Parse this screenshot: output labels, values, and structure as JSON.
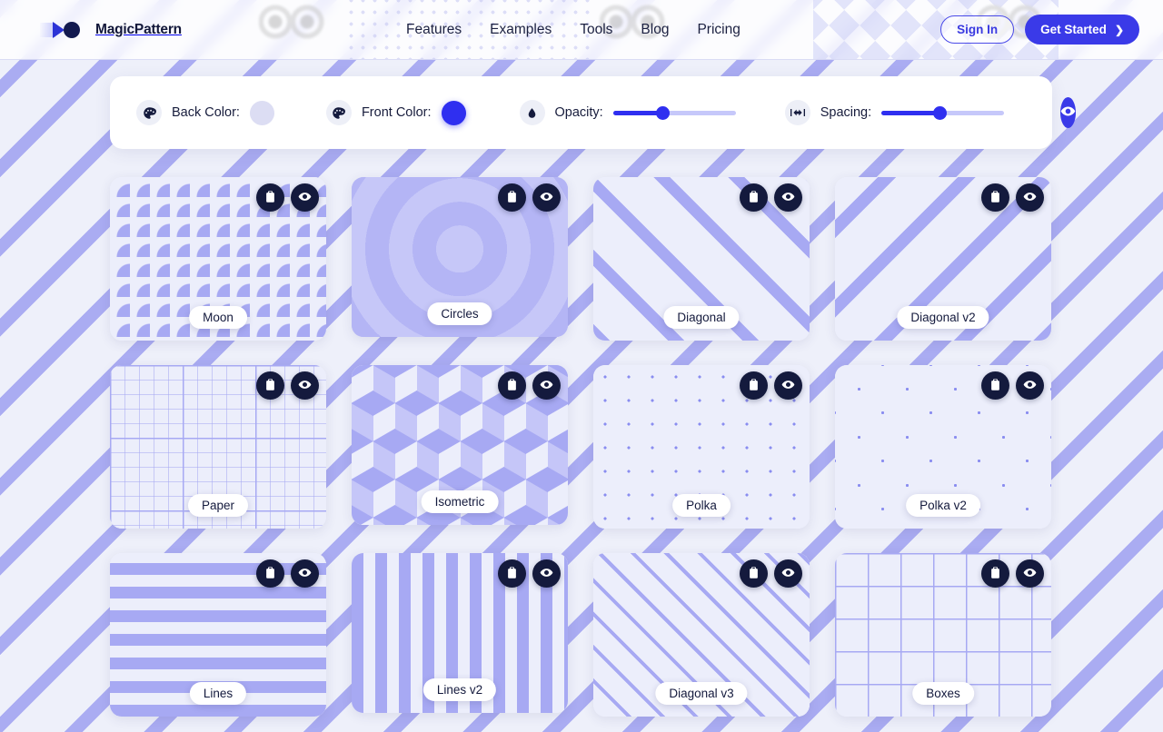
{
  "header": {
    "brand": "MagicPattern",
    "nav": [
      {
        "label": "Features"
      },
      {
        "label": "Examples"
      },
      {
        "label": "Tools"
      },
      {
        "label": "Blog"
      },
      {
        "label": "Pricing"
      }
    ],
    "sign_in_label": "Sign In",
    "get_started_label": "Get Started",
    "get_started_chevron": "❯"
  },
  "controls": {
    "back_color": {
      "label": "Back Color:",
      "icon": "palette-icon",
      "value": "#DCDDF3"
    },
    "front_color": {
      "label": "Front Color:",
      "icon": "palette-icon",
      "value": "#2F2FF0"
    },
    "opacity": {
      "label": "Opacity:",
      "icon": "droplet-icon",
      "percent": 40
    },
    "spacing": {
      "label": "Spacing:",
      "icon": "arrows-horizontal-icon",
      "percent": 47
    },
    "preview_button": {
      "icon": "eye-icon"
    }
  },
  "card_actions": {
    "copy_label": "copy-icon",
    "preview_label": "eye-icon"
  },
  "patterns": [
    {
      "name": "Moon",
      "pattern_class": "p-moon",
      "featured": false
    },
    {
      "name": "Circles",
      "pattern_class": "p-circles",
      "featured": true
    },
    {
      "name": "Diagonal",
      "pattern_class": "p-diagonal",
      "featured": false
    },
    {
      "name": "Diagonal v2",
      "pattern_class": "p-diagonal2",
      "featured": false
    },
    {
      "name": "Paper",
      "pattern_class": "p-paper",
      "featured": false
    },
    {
      "name": "Isometric",
      "pattern_class": "p-isometric",
      "featured": true
    },
    {
      "name": "Polka",
      "pattern_class": "p-polka",
      "featured": false
    },
    {
      "name": "Polka v2",
      "pattern_class": "p-polka2",
      "featured": false
    },
    {
      "name": "Lines",
      "pattern_class": "p-lines",
      "featured": false
    },
    {
      "name": "Lines v2",
      "pattern_class": "p-lines2",
      "featured": true
    },
    {
      "name": "Diagonal v3",
      "pattern_class": "p-diagonal3",
      "featured": false
    },
    {
      "name": "Boxes",
      "pattern_class": "p-boxes",
      "featured": false
    }
  ],
  "theme": {
    "accent": "#3A3AE8",
    "front_color": "#2F2FF0",
    "pattern_color": "#A7A9F3",
    "page_bg": "#EEF0FA",
    "badge_bg": "#141A3D"
  }
}
